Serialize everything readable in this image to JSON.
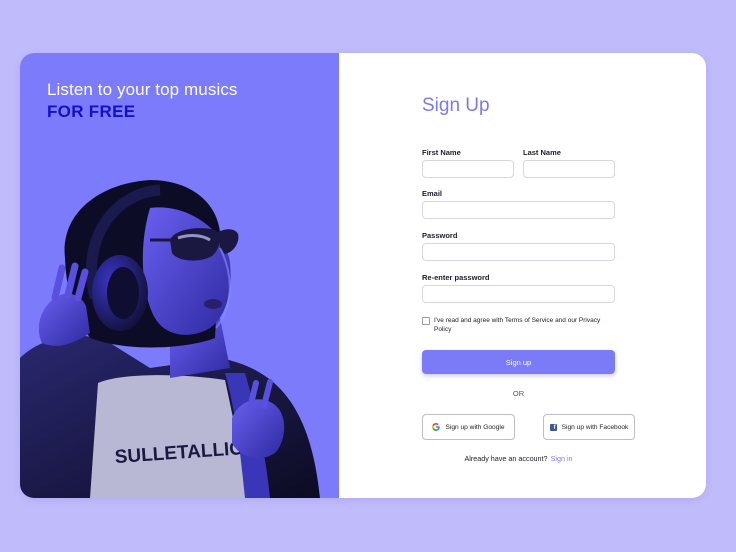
{
  "hero": {
    "title": "Listen to your top musics",
    "highlight": "FOR FREE"
  },
  "form": {
    "title": "Sign Up",
    "first_name": {
      "label": "First Name",
      "value": ""
    },
    "last_name": {
      "label": "Last Name",
      "value": ""
    },
    "email": {
      "label": "Email",
      "value": ""
    },
    "password": {
      "label": "Password",
      "value": ""
    },
    "reenter_password": {
      "label": "Re-enter password",
      "value": ""
    },
    "agree_text": "I've read and agree with Terms of Service and our Privacy Policy",
    "agree_checked": false,
    "submit_label": "Sign up",
    "divider": "OR",
    "google_label": "Sign up with Google",
    "facebook_label": "Sign up with Facebook",
    "account_prompt": "Already have an account?",
    "signin_label": "Sign in"
  },
  "colors": {
    "background": "#c0bcfb",
    "hero_panel": "#7b7bfb",
    "accent": "#7b7bf8",
    "highlight": "#1510c8"
  },
  "icons": {
    "google": "google-g-icon",
    "facebook": "facebook-f-icon"
  }
}
